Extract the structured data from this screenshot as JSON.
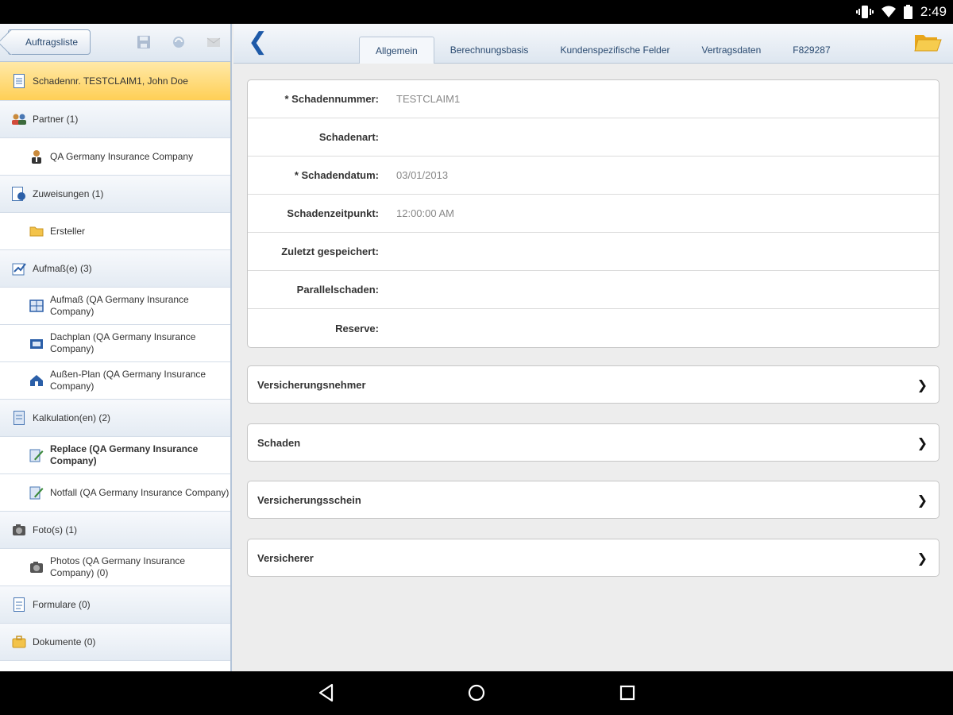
{
  "status_bar": {
    "time": "2:49"
  },
  "sidebar": {
    "back_button": "Auftragsliste",
    "items": [
      {
        "label": "Schadennr. TESTCLAIM1, John Doe",
        "kind": "selected",
        "icon": "document-icon"
      },
      {
        "label": "Partner (1)",
        "kind": "cat",
        "icon": "people-icon"
      },
      {
        "label": "QA Germany Insurance Company",
        "kind": "child",
        "icon": "person-icon"
      },
      {
        "label": "Zuweisungen (1)",
        "kind": "cat",
        "icon": "assignment-icon"
      },
      {
        "label": "Ersteller",
        "kind": "child",
        "icon": "folder-icon"
      },
      {
        "label": "Aufmaß(e) (3)",
        "kind": "cat",
        "icon": "measure-icon"
      },
      {
        "label": "Aufmaß (QA Germany Insurance Company)",
        "kind": "child",
        "icon": "floorplan-icon"
      },
      {
        "label": "Dachplan (QA Germany Insurance Company)",
        "kind": "child",
        "icon": "roofplan-icon"
      },
      {
        "label": "Außen-Plan (QA Germany Insurance Company)",
        "kind": "child",
        "icon": "house-icon"
      },
      {
        "label": "Kalkulation(en) (2)",
        "kind": "cat",
        "icon": "calculation-icon"
      },
      {
        "label": "Replace (QA Germany Insurance Company)",
        "kind": "child-bold",
        "icon": "edit-doc-icon"
      },
      {
        "label": "Notfall (QA Germany Insurance Company)",
        "kind": "child",
        "icon": "edit-doc-icon"
      },
      {
        "label": "Foto(s) (1)",
        "kind": "cat",
        "icon": "camera-icon"
      },
      {
        "label": "Photos (QA Germany Insurance Company) (0)",
        "kind": "child",
        "icon": "camera-icon"
      },
      {
        "label": "Formulare (0)",
        "kind": "cat",
        "icon": "form-icon"
      },
      {
        "label": "Dokumente (0)",
        "kind": "cat",
        "icon": "briefcase-icon"
      }
    ]
  },
  "main": {
    "tabs": [
      {
        "label": "Allgemein",
        "active": true
      },
      {
        "label": "Berechnungsbasis",
        "active": false
      },
      {
        "label": "Kundenspezifische Felder",
        "active": false
      },
      {
        "label": "Vertragsdaten",
        "active": false
      },
      {
        "label": "F829287",
        "active": false
      }
    ],
    "fields": [
      {
        "label": "* Schadennummer:",
        "value": "TESTCLAIM1"
      },
      {
        "label": "Schadenart:",
        "value": ""
      },
      {
        "label": "* Schadendatum:",
        "value": "03/01/2013"
      },
      {
        "label": "Schadenzeitpunkt:",
        "value": "12:00:00 AM"
      },
      {
        "label": "Zuletzt gespeichert:",
        "value": ""
      },
      {
        "label": "Parallelschaden:",
        "value": ""
      },
      {
        "label": "Reserve:",
        "value": ""
      }
    ],
    "sections": [
      {
        "title": "Versicherungsnehmer"
      },
      {
        "title": "Schaden"
      },
      {
        "title": "Versicherungsschein"
      },
      {
        "title": "Versicherer"
      }
    ]
  },
  "colors": {
    "selected_bg": "#ffcf55",
    "accent_blue": "#1e5aa8",
    "toolbar_bg": "#dde6f0"
  }
}
